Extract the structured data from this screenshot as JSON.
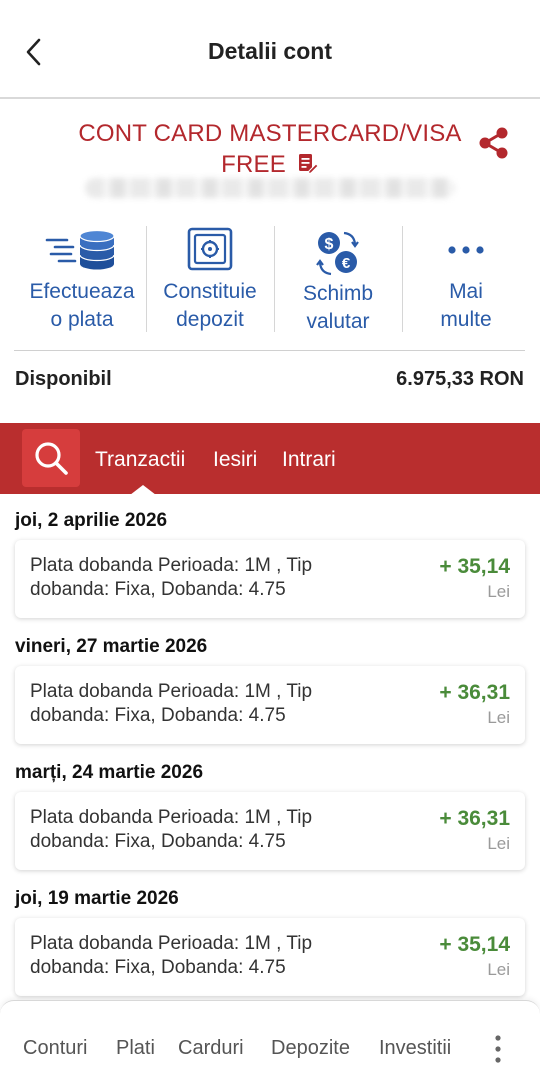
{
  "header": {
    "title": "Detalii cont",
    "back_icon": "chevron-left-icon"
  },
  "account": {
    "name_line1": "CONT CARD MASTERCARD/VISA",
    "name_line2": "FREE",
    "edit_icon": "edit-note-icon",
    "share_icon": "share-icon",
    "brand_color": "#b3282d"
  },
  "actions": [
    {
      "id": "payment",
      "icon": "coin-stack-icon",
      "line1": "Efectueaza",
      "line2": "o plata"
    },
    {
      "id": "deposit",
      "icon": "safe-icon",
      "line1": "Constituie",
      "line2": "depozit"
    },
    {
      "id": "exchange",
      "icon": "currency-exchange-icon",
      "line1": "Schimb",
      "line2": "valutar"
    },
    {
      "id": "more",
      "icon": "more-horizontal-icon",
      "line1": "Mai",
      "line2": "multe"
    }
  ],
  "balance": {
    "label": "Disponibil",
    "value": "6.975,33 RON"
  },
  "tabs": {
    "search_icon": "search-icon",
    "items": [
      "Tranzactii",
      "Iesiri",
      "Intrari"
    ],
    "active": "Tranzactii",
    "bar_color": "#b92e2e"
  },
  "transactions": [
    {
      "date": "joi, 2 aprilie 2026",
      "desc_line1": "Plata dobanda Perioada: 1M , Tip",
      "desc_line2": "dobanda: Fixa, Dobanda: 4.75",
      "amount": "+ 35,14",
      "currency": "Lei"
    },
    {
      "date": "vineri, 27 martie 2026",
      "desc_line1": "Plata dobanda Perioada: 1M , Tip",
      "desc_line2": "dobanda: Fixa, Dobanda: 4.75",
      "amount": "+ 36,31",
      "currency": "Lei"
    },
    {
      "date": "marți, 24 martie 2026",
      "desc_line1": "Plata dobanda Perioada: 1M , Tip",
      "desc_line2": "dobanda: Fixa, Dobanda: 4.75",
      "amount": "+ 36,31",
      "currency": "Lei"
    },
    {
      "date": "joi, 19 martie 2026",
      "desc_line1": "Plata dobanda Perioada: 1M , Tip",
      "desc_line2": "dobanda: Fixa, Dobanda: 4.75",
      "amount": "+ 35,14",
      "currency": "Lei"
    }
  ],
  "bottom_nav": {
    "items": [
      "Conturi",
      "Plati",
      "Carduri",
      "Depozite",
      "Investitii"
    ],
    "more_icon": "more-vertical-icon"
  },
  "colors": {
    "positive_amount": "#4a8b3a",
    "action_label": "#2a5ba8"
  }
}
